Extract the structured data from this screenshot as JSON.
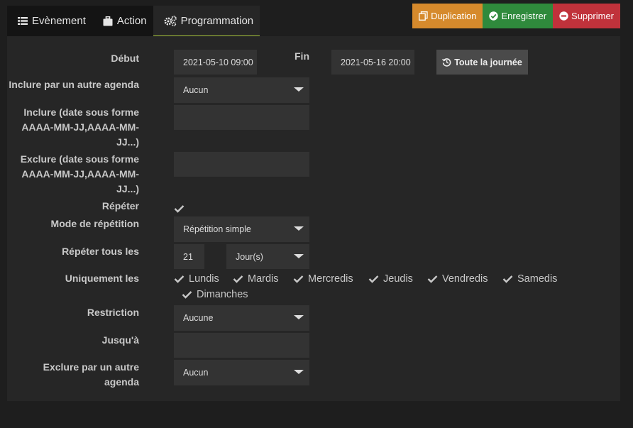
{
  "tabs": [
    {
      "label": "Evènement",
      "icon": "list-icon"
    },
    {
      "label": "Action",
      "icon": "briefcase-icon"
    },
    {
      "label": "Programmation",
      "icon": "cogs-icon",
      "active": true
    }
  ],
  "toolbar": {
    "duplicate_label": "Duplication",
    "save_label": "Enregistrer",
    "delete_label": "Supprimer"
  },
  "colors": {
    "duplicate": "#d68a2c",
    "save": "#2f8a3c",
    "delete": "#c0323b",
    "active_tab_border": "#a7c43a"
  },
  "form": {
    "start_label": "Début",
    "start_value": "2021-05-10 09:00",
    "end_label": "Fin",
    "end_value": "2021-05-16 20:00",
    "all_day_label": "Toute la journée",
    "include_agenda_label": "Inclure par un autre agenda",
    "include_agenda_value": "Aucun",
    "include_dates_label_1": "Inclure (date sous forme",
    "include_dates_label_2": "AAAA-MM-JJ,AAAA-MM-",
    "include_dates_label_3": "JJ...)",
    "include_dates_value": "",
    "exclude_dates_label_1": "Exclure (date sous forme",
    "exclude_dates_label_2": "AAAA-MM-JJ,AAAA-MM-",
    "exclude_dates_label_3": "JJ...)",
    "exclude_dates_value": "",
    "repeat_label": "Répéter",
    "repeat_checked": true,
    "repeat_mode_label": "Mode de répétition",
    "repeat_mode_value": "Répétition simple",
    "repeat_every_label": "Répéter tous les",
    "repeat_every_value": "21",
    "repeat_unit_value": "Jour(s)",
    "only_label": "Uniquement les",
    "days": [
      "Lundis",
      "Mardis",
      "Mercredis",
      "Jeudis",
      "Vendredis",
      "Samedis",
      "Dimanches"
    ],
    "restriction_label": "Restriction",
    "restriction_value": "Aucune",
    "until_label": "Jusqu'à",
    "until_value": "",
    "exclude_agenda_label_1": "Exclure par un autre",
    "exclude_agenda_label_2": "agenda",
    "exclude_agenda_value": "Aucun"
  }
}
